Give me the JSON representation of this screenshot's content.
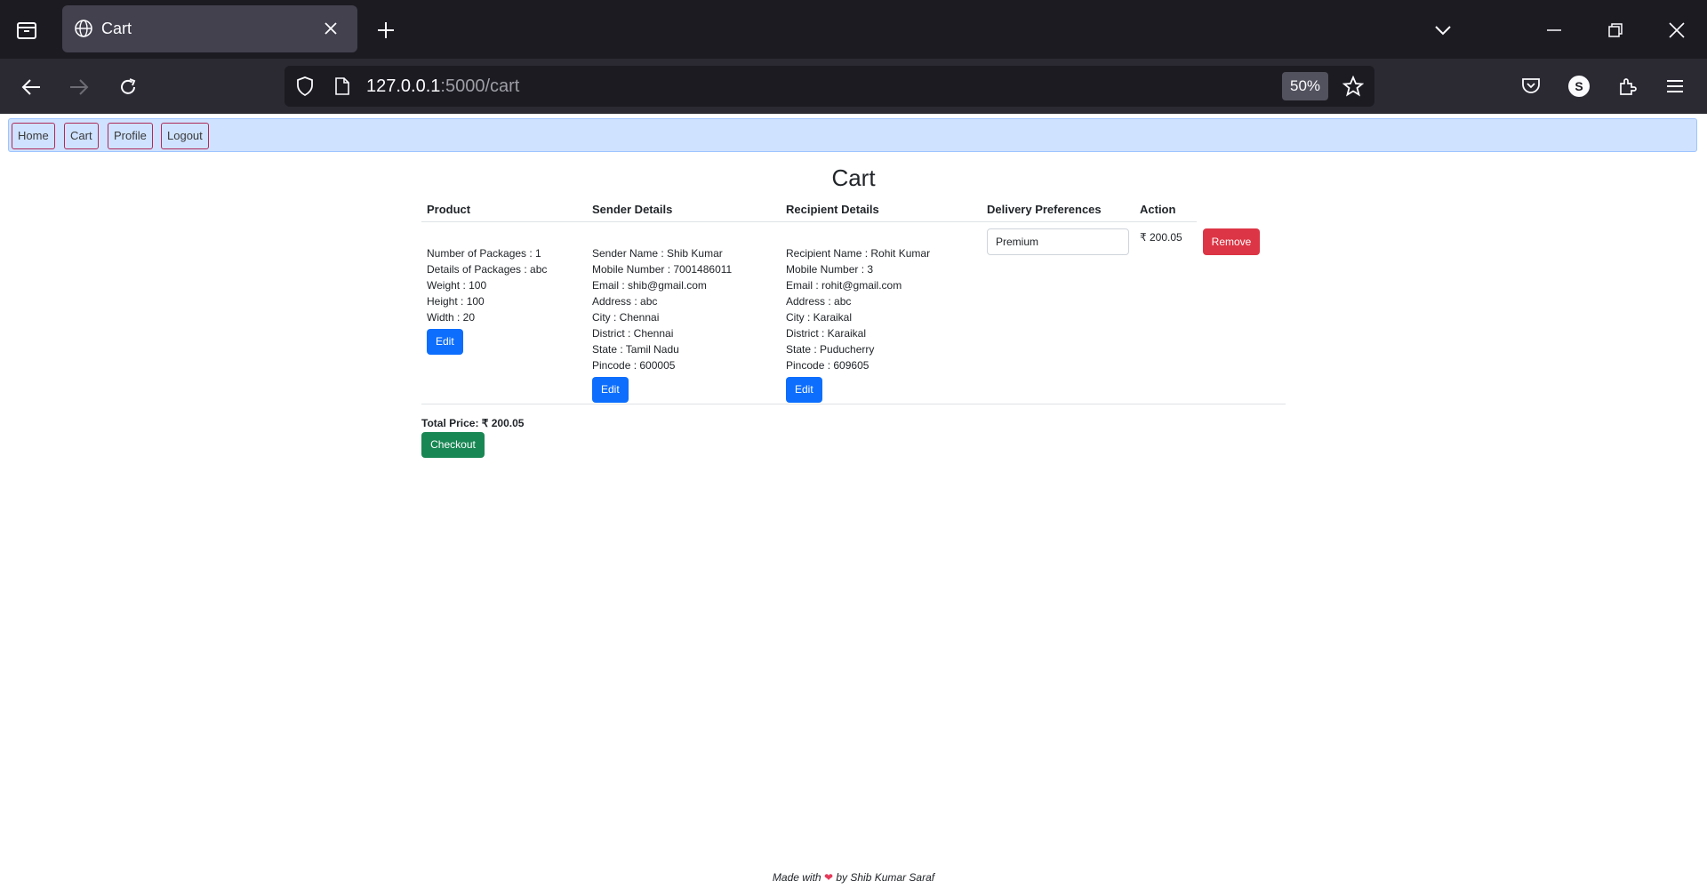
{
  "browser": {
    "tab_title": "Cart",
    "url_host": "127.0.0.1",
    "url_path": ":5000/cart",
    "zoom": "50%",
    "profile_initial": "S"
  },
  "nav": {
    "items": [
      "Home",
      "Cart",
      "Profile",
      "Logout"
    ]
  },
  "page": {
    "title": "Cart"
  },
  "table": {
    "headers": [
      "Product",
      "Sender Details",
      "Recipient Details",
      "Delivery Preferences",
      "Action"
    ],
    "row": {
      "product": [
        "Number of Packages : 1",
        "Details of Packages : abc",
        "Weight : 100",
        "Height : 100",
        "Width : 20"
      ],
      "sender": [
        "Sender Name : Shib Kumar",
        "Mobile Number : 7001486011",
        "Email : shib@gmail.com",
        "Address : abc",
        "City : Chennai",
        "District : Chennai",
        "State : Tamil Nadu",
        "Pincode : 600005"
      ],
      "recipient": [
        "Recipient Name : Rohit Kumar",
        "Mobile Number : 3",
        "Email : rohit@gmail.com",
        "Address : abc",
        "City : Karaikal",
        "District : Karaikal",
        "State : Puducherry",
        "Pincode : 609605"
      ],
      "delivery_preference": "Premium",
      "price": "₹ 200.05",
      "remove_label": "Remove",
      "edit_label": "Edit"
    }
  },
  "summary": {
    "total_price": "Total Price: ₹ 200.05",
    "checkout_label": "Checkout"
  },
  "footer": {
    "prefix": "Made with",
    "heart": "❤",
    "suffix": "by Shib Kumar Saraf"
  }
}
